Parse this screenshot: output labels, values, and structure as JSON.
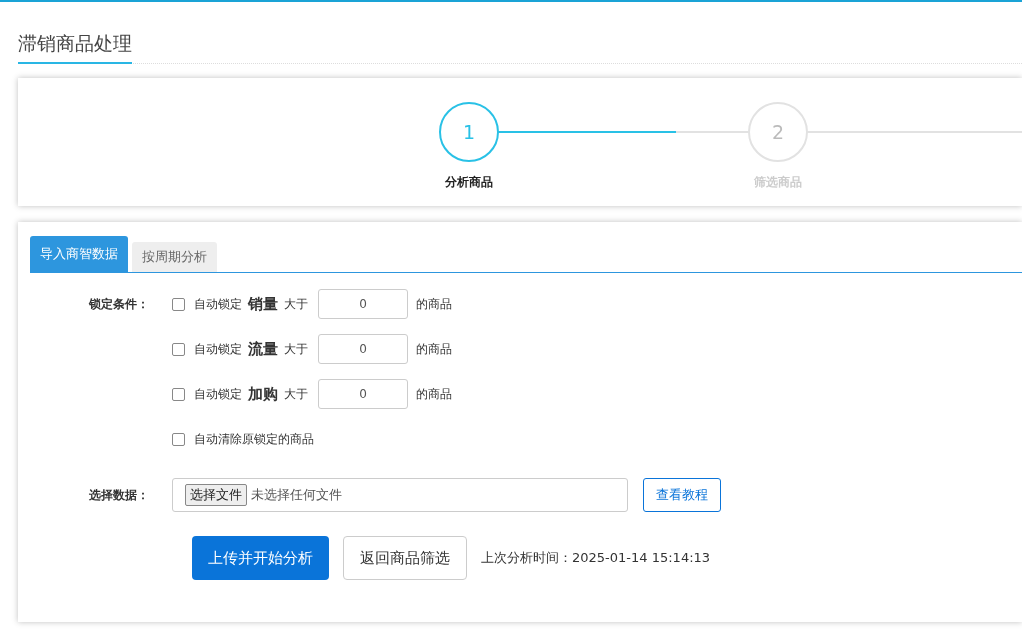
{
  "page_title": "滞销商品处理",
  "steps": [
    {
      "number": "1",
      "label": "分析商品",
      "active": true
    },
    {
      "number": "2",
      "label": "筛选商品",
      "active": false
    }
  ],
  "tabs": [
    {
      "label": "导入商智数据",
      "selected": true
    },
    {
      "label": "按周期分析",
      "selected": false
    }
  ],
  "lock_conditions": {
    "label": "锁定条件：",
    "rules": [
      {
        "checked": false,
        "prefix": "自动锁定",
        "metric": "销量",
        "comparison": "大于",
        "value": "0",
        "suffix": "的商品"
      },
      {
        "checked": false,
        "prefix": "自动锁定",
        "metric": "流量",
        "comparison": "大于",
        "value": "0",
        "suffix": "的商品"
      },
      {
        "checked": false,
        "prefix": "自动锁定",
        "metric": "加购",
        "comparison": "大于",
        "value": "0",
        "suffix": "的商品"
      }
    ],
    "clear_option": {
      "checked": false,
      "label": "自动清除原锁定的商品"
    }
  },
  "data_source": {
    "label": "选择数据：",
    "file_button": "选择文件",
    "file_status": "未选择任何文件",
    "tutorial_button": "查看教程"
  },
  "actions": {
    "primary": "上传并开始分析",
    "secondary": "返回商品筛选",
    "last_analysis": "上次分析时间：2025-01-14 15:14:13"
  }
}
